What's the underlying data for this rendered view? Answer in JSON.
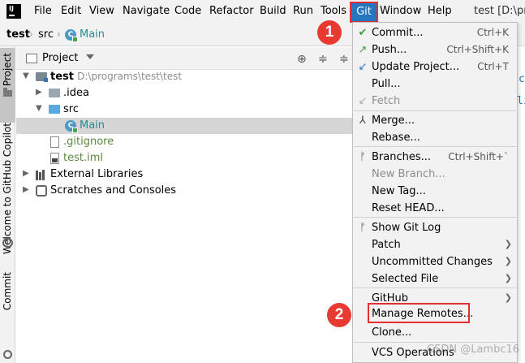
{
  "menubar": {
    "items": [
      "File",
      "Edit",
      "View",
      "Navigate",
      "Code",
      "Refactor",
      "Build",
      "Run",
      "Tools",
      "Git",
      "Window",
      "Help"
    ],
    "window_title": "test [D:\\pro"
  },
  "breadcrumb": {
    "project": "test",
    "folder": "src",
    "file": "Main"
  },
  "toolstrip": {
    "project_label": "Project",
    "copilot_label": "Welcome to GitHub Copilot",
    "commit_label": "Commit"
  },
  "panel": {
    "title": "Project"
  },
  "tree": [
    {
      "label": "test",
      "path": "D:\\programs\\test\\test"
    },
    {
      "label": ".idea"
    },
    {
      "label": "src"
    },
    {
      "label": "Main"
    },
    {
      "label": ".gitignore"
    },
    {
      "label": "test.iml"
    },
    {
      "label": "External Libraries"
    },
    {
      "label": "Scratches and Consoles"
    }
  ],
  "git_menu": {
    "commit": {
      "label": "Commit...",
      "shortcut": "Ctrl+K"
    },
    "push": {
      "label": "Push...",
      "shortcut": "Ctrl+Shift+K"
    },
    "update_project": {
      "label": "Update Project...",
      "shortcut": "Ctrl+T"
    },
    "pull": {
      "label": "Pull..."
    },
    "fetch": {
      "label": "Fetch"
    },
    "merge": {
      "label": "Merge..."
    },
    "rebase": {
      "label": "Rebase..."
    },
    "branches": {
      "label": "Branches...",
      "shortcut": "Ctrl+Shift+`"
    },
    "new_branch": {
      "label": "New Branch..."
    },
    "new_tag": {
      "label": "New Tag..."
    },
    "reset_head": {
      "label": "Reset HEAD..."
    },
    "show_git_log": {
      "label": "Show Git Log"
    },
    "patch": {
      "label": "Patch"
    },
    "uncommitted_changes": {
      "label": "Uncommitted Changes"
    },
    "selected_file": {
      "label": "Selected File"
    },
    "github": {
      "label": "GitHub"
    },
    "manage_remotes": {
      "label": "Manage Remotes..."
    },
    "clone": {
      "label": "Clone..."
    },
    "vcs_operations": {
      "label": "VCS Operations"
    }
  },
  "badges": {
    "step1": "1",
    "step2": "2"
  },
  "editor": {
    "snippet_1": "c",
    "snippet_2": "li"
  },
  "watermark": "CSDN @Lambc16",
  "colors": {
    "accent": "#2675bf",
    "badge": "#e83a30",
    "highlight": "#e03030"
  }
}
